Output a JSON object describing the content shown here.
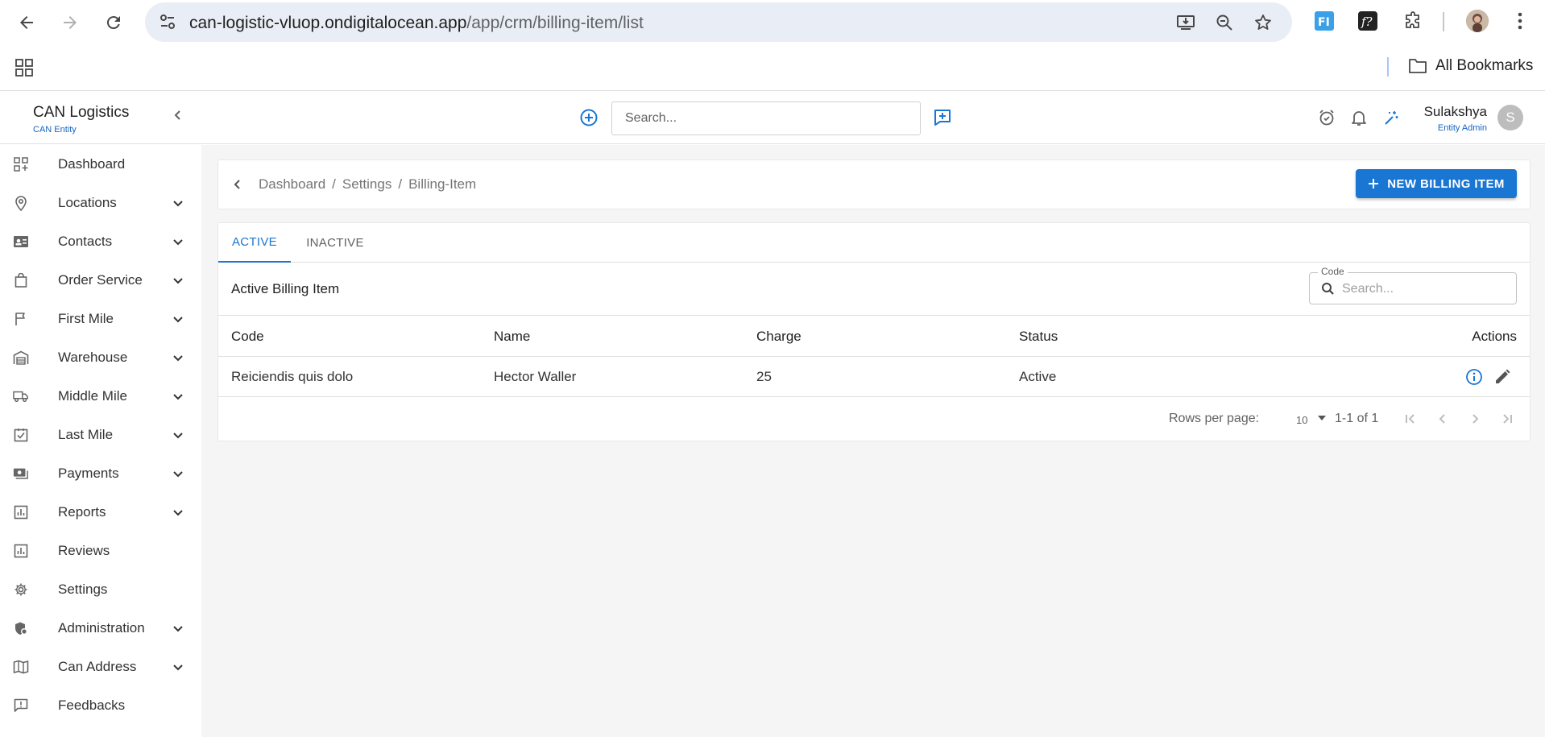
{
  "browser": {
    "url_host": "can-logistic-vluop.ondigitalocean.app",
    "url_path": "/app/crm/billing-item/list",
    "all_bookmarks_label": "All Bookmarks"
  },
  "header": {
    "brand_title": "CAN Logistics",
    "brand_subtitle": "CAN Entity",
    "search_placeholder": "Search...",
    "user_name": "Sulakshya",
    "user_role": "Entity Admin",
    "avatar_initial": "S"
  },
  "sidebar": {
    "items": [
      {
        "label": "Dashboard",
        "icon": "dashboard-icon",
        "expandable": false
      },
      {
        "label": "Locations",
        "icon": "location-pin-icon",
        "expandable": true
      },
      {
        "label": "Contacts",
        "icon": "contact-card-icon",
        "expandable": true
      },
      {
        "label": "Order Service",
        "icon": "shopping-bag-icon",
        "expandable": true
      },
      {
        "label": "First Mile",
        "icon": "flag-icon",
        "expandable": true
      },
      {
        "label": "Warehouse",
        "icon": "warehouse-icon",
        "expandable": true
      },
      {
        "label": "Middle Mile",
        "icon": "truck-icon",
        "expandable": true
      },
      {
        "label": "Last Mile",
        "icon": "checkbox-icon",
        "expandable": true
      },
      {
        "label": "Payments",
        "icon": "payments-icon",
        "expandable": true
      },
      {
        "label": "Reports",
        "icon": "bar-chart-icon",
        "expandable": true
      },
      {
        "label": "Reviews",
        "icon": "reviews-icon",
        "expandable": false
      },
      {
        "label": "Settings",
        "icon": "gear-icon",
        "expandable": false
      },
      {
        "label": "Administration",
        "icon": "admin-shield-icon",
        "expandable": true
      },
      {
        "label": "Can Address",
        "icon": "map-icon",
        "expandable": true
      },
      {
        "label": "Feedbacks",
        "icon": "feedback-icon",
        "expandable": false
      }
    ]
  },
  "breadcrumb": {
    "items": [
      "Dashboard",
      "Settings",
      "Billing-Item"
    ],
    "separator": "/"
  },
  "new_button_label": "NEW BILLING ITEM",
  "tabs": [
    {
      "label": "ACTIVE",
      "active": true
    },
    {
      "label": "INACTIVE",
      "active": false
    }
  ],
  "table": {
    "title": "Active Billing Item",
    "filter_label": "Code",
    "filter_placeholder": "Search...",
    "columns": [
      "Code",
      "Name",
      "Charge",
      "Status",
      "Actions"
    ],
    "rows": [
      {
        "code": "Reiciendis quis dolo",
        "name": "Hector Waller",
        "charge": "25",
        "status": "Active"
      }
    ]
  },
  "pagination": {
    "rows_per_page_label": "Rows per page:",
    "rows_per_page_value": "10",
    "range_text": "1-1 of 1"
  },
  "colors": {
    "primary": "#1976d2",
    "background": "#f5f5f5"
  }
}
